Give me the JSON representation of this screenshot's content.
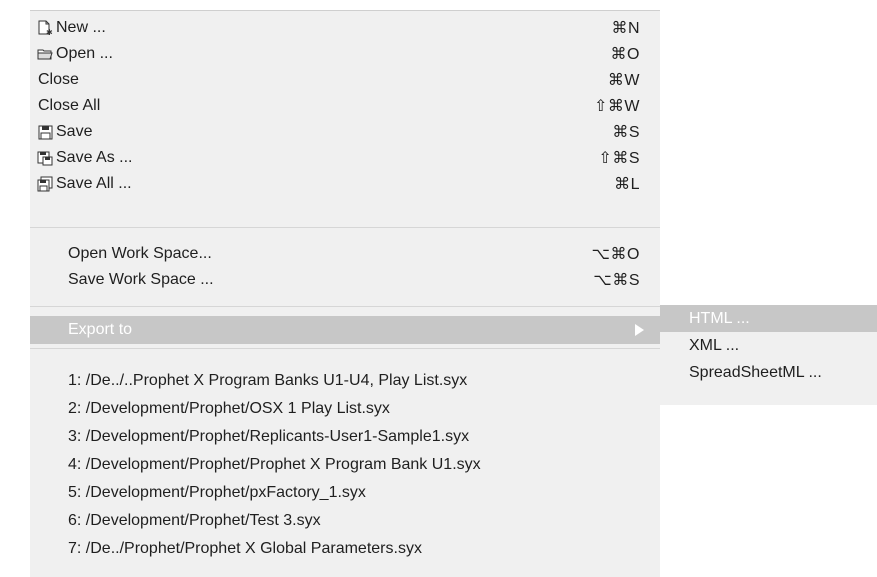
{
  "menu": {
    "items": [
      {
        "label": "New ...",
        "shortcut": "⌘N",
        "icon": "new-document-icon"
      },
      {
        "label": "Open ...",
        "shortcut": "⌘O",
        "icon": "open-folder-icon"
      },
      {
        "label": "Close",
        "shortcut": "⌘W"
      },
      {
        "label": "Close All",
        "shortcut": "⇧⌘W"
      },
      {
        "label": "Save",
        "shortcut": "⌘S",
        "icon": "save-disk-icon"
      },
      {
        "label": "Save As ...",
        "shortcut": "⇧⌘S",
        "icon": "save-as-icon"
      },
      {
        "label": "Save All ...",
        "shortcut": "⌘L",
        "icon": "save-all-icon"
      }
    ],
    "workspace": [
      {
        "label": "Open Work Space...",
        "shortcut": "⌥⌘O"
      },
      {
        "label": "Save Work Space ...",
        "shortcut": "⌥⌘S"
      }
    ],
    "export_label": "Export to",
    "recent": [
      "1: /De../..Prophet X Program Banks U1-U4, Play List.syx",
      "2: /Development/Prophet/OSX 1 Play List.syx",
      "3: /Development/Prophet/Replicants-User1-Sample1.syx",
      "4: /Development/Prophet/Prophet X Program Bank U1.syx",
      "5: /Development/Prophet/pxFactory_1.syx",
      "6: /Development/Prophet/Test 3.syx",
      "7: /De../Prophet/Prophet X Global Parameters.syx"
    ]
  },
  "submenu": {
    "items": [
      "HTML ...",
      "XML ...",
      "SpreadSheetML ..."
    ],
    "selected": "HTML ..."
  },
  "colors": {
    "menu_bg": "#f0f0f0",
    "highlight": "#c7c7c7",
    "text": "#1f1f1f"
  }
}
